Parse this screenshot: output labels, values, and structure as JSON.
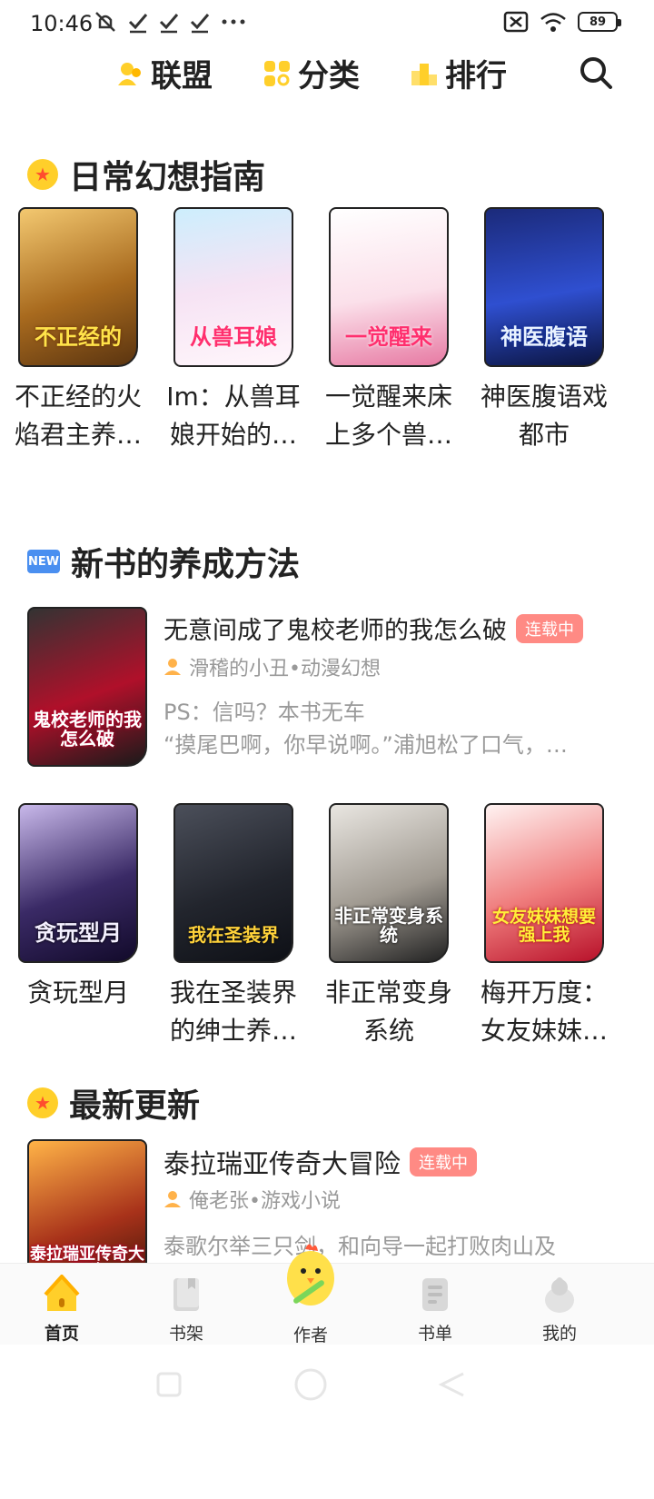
{
  "status_bar": {
    "time": "10:46",
    "battery": "89",
    "left_icons": [
      "mute-icon",
      "check-icon",
      "check-icon",
      "check-icon",
      "more-dots-icon"
    ],
    "right_icons": [
      "sim-off-icon",
      "wifi-icon",
      "battery-icon"
    ]
  },
  "top_nav": {
    "items": [
      {
        "label": "联盟",
        "icon": "alliance-icon"
      },
      {
        "label": "分类",
        "icon": "category-icon"
      },
      {
        "label": "排行",
        "icon": "ranking-icon"
      }
    ],
    "search_icon": "search-icon"
  },
  "sections": {
    "daily": {
      "title": "日常幻想指南",
      "books": [
        {
          "title_line1": "不正经的火",
          "title_line2": "焰君主养…",
          "cover_text": "不正经的"
        },
        {
          "title_line1": "Im：从兽耳",
          "title_line2": "娘开始的…",
          "cover_text": "从兽耳娘"
        },
        {
          "title_line1": "一觉醒来床",
          "title_line2": "上多个兽…",
          "cover_text": "一觉醒来"
        },
        {
          "title_line1": "神医腹语戏",
          "title_line2": "都市",
          "cover_text": "神医腹语"
        }
      ]
    },
    "new_books": {
      "badge": "NEW",
      "title": "新书的养成方法",
      "featured": {
        "title": "无意间成了鬼校老师的我怎么破",
        "status": "连载中",
        "author": "滑稽的小丑•动漫幻想",
        "desc1": "PS：信吗？本书无车",
        "desc2": "“摸尾巴啊，你早说啊。”浦旭松了口气，…",
        "cover_text": "鬼校老师的我怎么破"
      },
      "books": [
        {
          "title_line1": "贪玩型月",
          "title_line2": "",
          "cover_text": "贪玩型月"
        },
        {
          "title_line1": "我在圣装界",
          "title_line2": "的绅士养…",
          "cover_text": "我在圣装界"
        },
        {
          "title_line1": "非正常变身",
          "title_line2": "系统",
          "cover_text": "非正常变身系统"
        },
        {
          "title_line1": "梅开万度：",
          "title_line2": "女友妹妹…",
          "cover_text": "女友妹妹想要强上我"
        }
      ]
    },
    "latest": {
      "title": "最新更新",
      "featured": {
        "title": "泰拉瑞亚传奇大冒险",
        "status": "连载中",
        "author": "俺老张•游戏小说",
        "desc1": "泰歌尔举三只剑，和向导一起打败肉山及",
        "cover_text": "泰拉瑞亚传奇大冒险"
      }
    }
  },
  "tab_bar": {
    "tabs": [
      {
        "label": "首页",
        "icon": "home-icon"
      },
      {
        "label": "书架",
        "icon": "bookshelf-icon"
      },
      {
        "label": "作者",
        "icon": "author-chick-icon"
      },
      {
        "label": "书单",
        "icon": "booklist-icon"
      },
      {
        "label": "我的",
        "icon": "profile-icon"
      }
    ]
  },
  "colors": {
    "accent_yellow": "#ffcf2a",
    "tag_red": "#ff8a84",
    "new_blue": "#4a8ff0"
  }
}
